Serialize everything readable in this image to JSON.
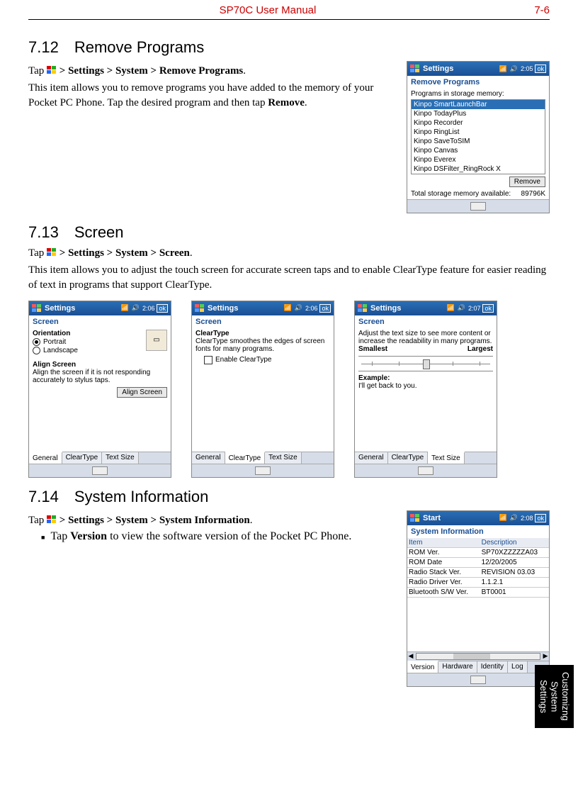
{
  "header": {
    "title": "SP70C User Manual",
    "page": "7-6"
  },
  "sidetab": {
    "line1": "Customizng",
    "line2": "System Settings"
  },
  "s712": {
    "heading": "7.12 Remove Programs",
    "p1_pre": "Tap ",
    "p1_path": " > Settings > System > Remove Programs",
    "p1_post": ".",
    "p2a": "This item allows you to remove programs you have added to the memory of your Pocket PC Phone. Tap the desired program and then tap ",
    "p2b": "Remove",
    "p2c": ".",
    "phone": {
      "title": "Settings",
      "time": "2:05",
      "ok": "ok",
      "sub": "Remove Programs",
      "label": "Programs in storage memory:",
      "items": [
        "Kinpo SmartLaunchBar",
        "Kinpo TodayPlus",
        "Kinpo Recorder",
        "Kinpo RingList",
        "Kinpo SaveToSIM",
        "Kinpo Canvas",
        "Kinpo Everex",
        "Kinpo DSFilter_RingRock X"
      ],
      "remove_btn": "Remove",
      "mem_label": "Total storage memory available:",
      "mem_val": "89796K"
    }
  },
  "s713": {
    "heading": "7.13 Screen",
    "p1_pre": "Tap ",
    "p1_path": " > Settings > System > Screen",
    "p1_post": ".",
    "p2": "This item allows you to adjust the touch screen for accurate screen taps and to enable ClearType feature for easier reading of text in programs that support ClearType.",
    "phone1": {
      "title": "Settings",
      "time": "2:06",
      "ok": "ok",
      "sub": "Screen",
      "orientation": "Orientation",
      "portrait": "Portrait",
      "landscape": "Landscape",
      "align_h": "Align Screen",
      "align_txt": "Align the screen if it is not responding accurately to stylus taps.",
      "align_btn": "Align Screen",
      "tabs": [
        "General",
        "ClearType",
        "Text Size"
      ],
      "active": 0
    },
    "phone2": {
      "title": "Settings",
      "time": "2:06",
      "ok": "ok",
      "sub": "Screen",
      "h": "ClearType",
      "txt": "ClearType smoothes the edges of screen fonts for many programs.",
      "cb": "Enable ClearType",
      "tabs": [
        "General",
        "ClearType",
        "Text Size"
      ],
      "active": 1
    },
    "phone3": {
      "title": "Settings",
      "time": "2:07",
      "ok": "ok",
      "sub": "Screen",
      "txt": "Adjust the text size to see more content or increase the readability in many programs.",
      "small": "Smallest",
      "large": "Largest",
      "example_h": "Example:",
      "example": "I'll get back to you.",
      "tabs": [
        "General",
        "ClearType",
        "Text Size"
      ],
      "active": 2
    }
  },
  "s714": {
    "heading": "7.14 System Information",
    "p1_pre": "Tap ",
    "p1_path": " > Settings > System > System Information",
    "p1_post": ".",
    "li_a": "Tap ",
    "li_b": "Version",
    "li_c": " to view the software version of the Pocket PC Phone.",
    "phone": {
      "title": "Start",
      "time": "2:08",
      "ok": "ok",
      "sub": "System Information",
      "col1": "Item",
      "col2": "Description",
      "rows": [
        [
          "ROM Ver.",
          "SP70XZZZZZA03"
        ],
        [
          "ROM Date",
          "12/20/2005"
        ],
        [
          "Radio Stack Ver.",
          "REVISION 03.03"
        ],
        [
          "Radio Driver Ver.",
          "1.1.2.1"
        ],
        [
          "Bluetooth S/W Ver.",
          "BT0001"
        ]
      ],
      "tabs": [
        "Version",
        "Hardware",
        "Identity",
        "Log"
      ],
      "active": 0
    }
  }
}
